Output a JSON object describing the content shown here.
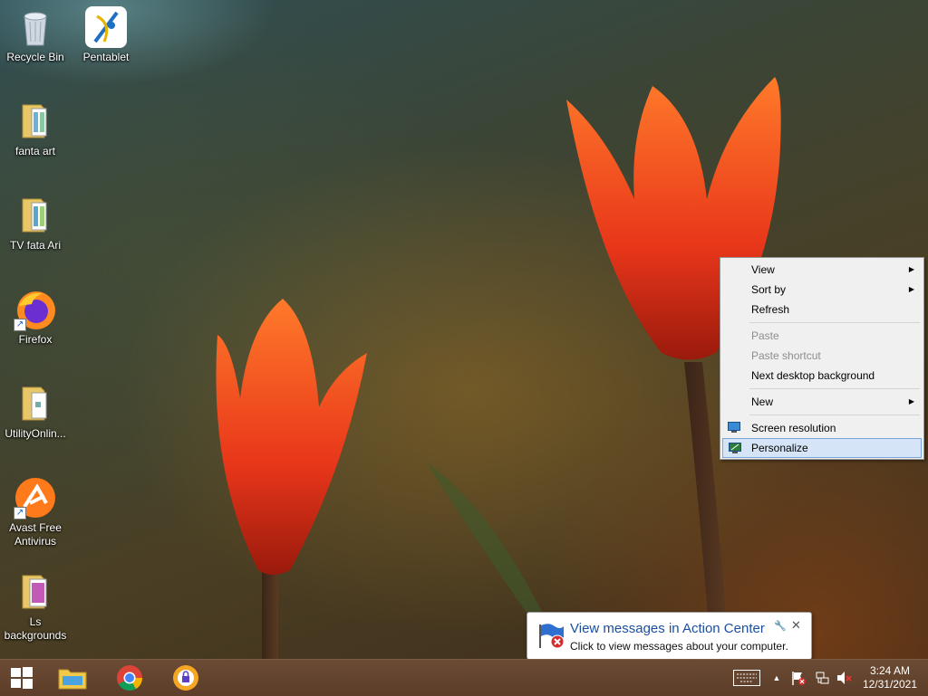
{
  "desktop_icons": [
    {
      "label": "Recycle Bin",
      "icon": "recycle-bin-icon"
    },
    {
      "label": "Pentablet",
      "icon": "pentablet-icon"
    },
    {
      "label": "fanta art",
      "icon": "folder-icon"
    },
    {
      "label": "TV  fata Ari",
      "icon": "folder-icon"
    },
    {
      "label": "Firefox",
      "icon": "firefox-icon"
    },
    {
      "label": "UtilityOnlin...",
      "icon": "folder-icon"
    },
    {
      "label": "Avast Free Antivirus",
      "icon": "avast-icon"
    },
    {
      "label": "Ls backgrounds",
      "icon": "folder-icon"
    }
  ],
  "context_menu": {
    "items": [
      {
        "label": "View",
        "submenu": true,
        "enabled": true
      },
      {
        "label": "Sort by",
        "submenu": true,
        "enabled": true
      },
      {
        "label": "Refresh",
        "enabled": true
      },
      {
        "label": "Paste",
        "enabled": false
      },
      {
        "label": "Paste shortcut",
        "enabled": false
      },
      {
        "label": "Next desktop background",
        "enabled": true
      },
      {
        "label": "New",
        "submenu": true,
        "enabled": true
      },
      {
        "label": "Screen resolution",
        "enabled": true
      },
      {
        "label": "Personalize",
        "enabled": true,
        "highlighted": true
      }
    ]
  },
  "balloon": {
    "title": "View messages in Action Center",
    "message": "Click to view messages about your computer."
  },
  "taskbar": {
    "pinned": [
      "start-icon",
      "file-explorer-icon",
      "chrome-icon",
      "vpn-lock-icon"
    ],
    "clock_time": "3:24 AM",
    "clock_date": "12/31/2021"
  },
  "colors": {
    "menu_highlight": "#d5e4f7",
    "balloon_title": "#1a4fa0",
    "taskbar": "#5c3d29"
  }
}
